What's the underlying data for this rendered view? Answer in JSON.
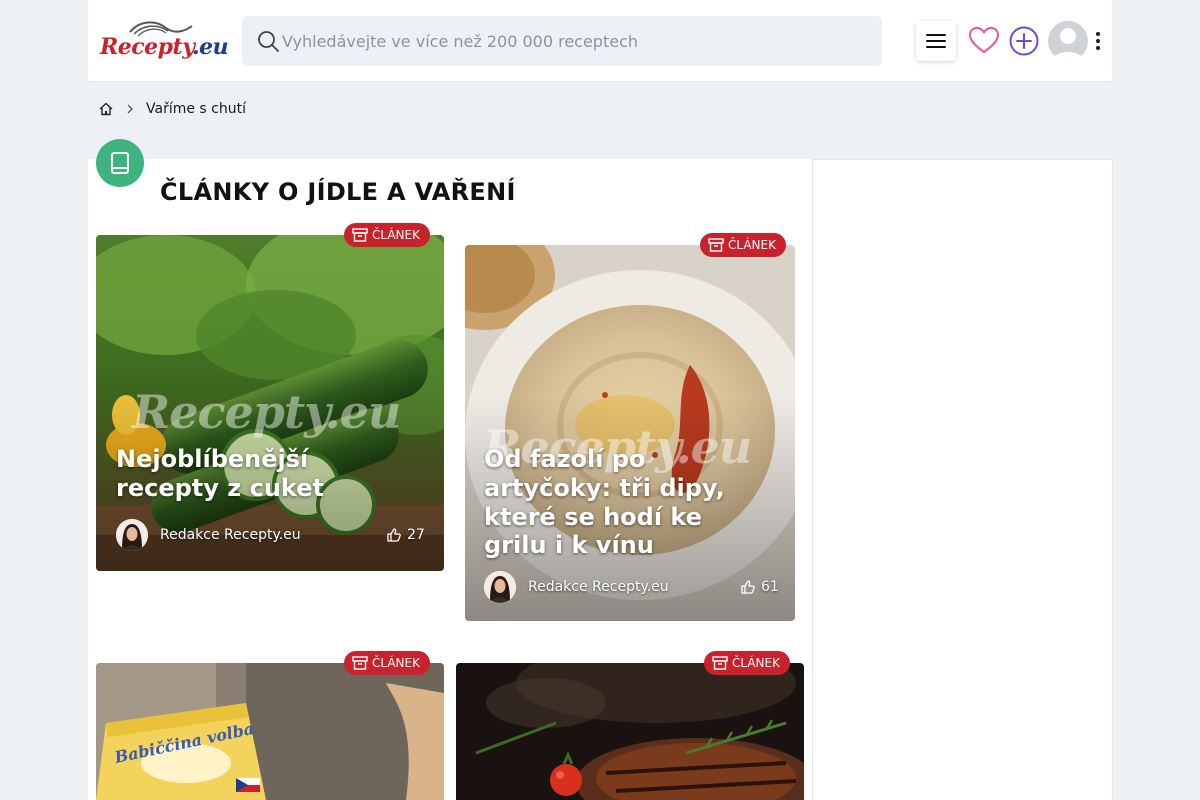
{
  "header": {
    "logo_text": "Recepty",
    "logo_suffix": ".eu",
    "search_placeholder": "Vyhledávejte ve více než 200 000 receptech",
    "icons": [
      "search-icon",
      "menu-icon",
      "heart-icon",
      "plus-icon",
      "avatar",
      "kebab-icon"
    ]
  },
  "breadcrumb": {
    "current": "Vaříme s chutí"
  },
  "page": {
    "title": "ČLÁNKY O JÍDLE A VAŘENÍ",
    "section_icon": "book-icon"
  },
  "cards": [
    {
      "badge": "ČLÁNEK",
      "title": "Nejoblíbenější recepty z cuket",
      "author": "Redakce Recepty.eu",
      "likes": "27",
      "watermark": "Recepty.eu"
    },
    {
      "badge": "ČLÁNEK",
      "title": "Od fazolí po artyčoky: tři dipy, které se hodí ke grilu i k vínu",
      "author": "Redakce Recepty.eu",
      "likes": "61",
      "watermark": "Recepty.eu"
    },
    {
      "badge": "ČLÁNEK"
    },
    {
      "badge": "ČLÁNEK"
    }
  ],
  "colors": {
    "brand_red": "#c8232c",
    "brand_blue": "#1c3d8c",
    "section_green": "#3fb37e",
    "heart_pink": "#e8559b",
    "plus_purple": "#6a4fd6"
  }
}
